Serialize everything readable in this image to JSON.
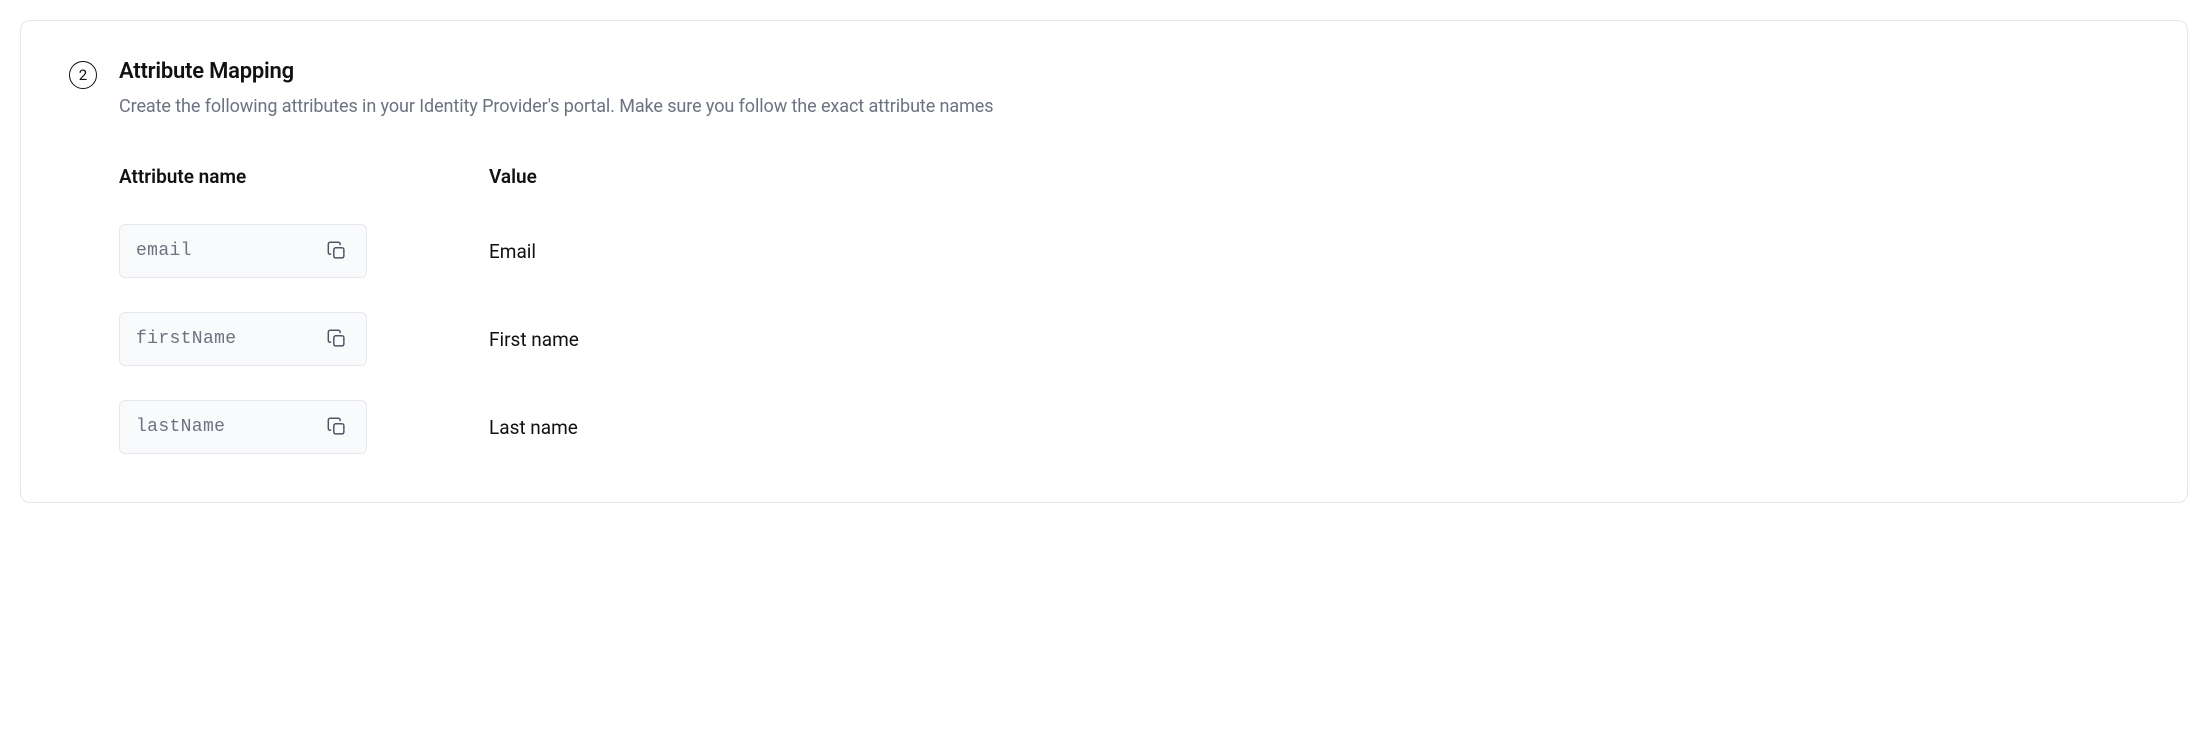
{
  "step": {
    "number": "2",
    "title": "Attribute Mapping",
    "subtitle": "Create the following attributes in your Identity Provider's portal. Make sure you follow the exact attribute names"
  },
  "table": {
    "headers": {
      "attribute": "Attribute name",
      "value": "Value"
    },
    "rows": [
      {
        "attribute": "email",
        "value": "Email"
      },
      {
        "attribute": "firstName",
        "value": "First name"
      },
      {
        "attribute": "lastName",
        "value": "Last name"
      }
    ]
  }
}
